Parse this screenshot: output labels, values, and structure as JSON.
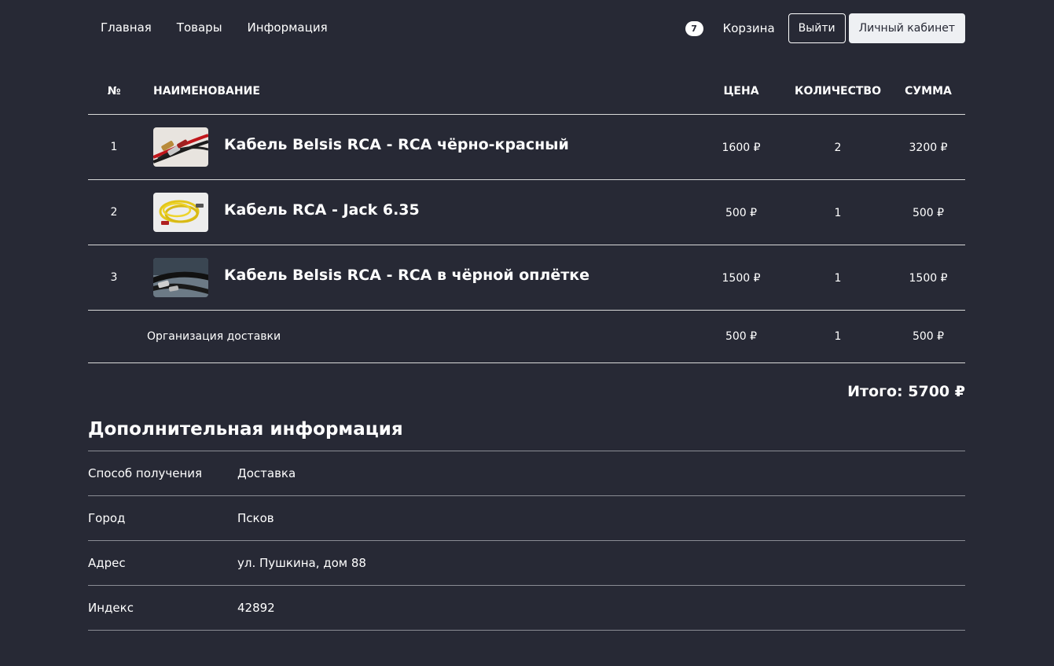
{
  "nav": {
    "links": [
      "Главная",
      "Товары",
      "Информация"
    ],
    "cart_count": "7",
    "cart_label": "Корзина",
    "logout_label": "Выйти",
    "account_label": "Личный кабинет"
  },
  "table": {
    "headers": {
      "num": "№",
      "name": "НАИМЕНОВАНИЕ",
      "price": "ЦЕНА",
      "qty": "КОЛИЧЕСТВО",
      "sum": "СУММА"
    },
    "items": [
      {
        "num": "1",
        "name": "Кабель Belsis RCA - RCA чёрно-красный",
        "price": "1600 ₽",
        "qty": "2",
        "sum": "3200 ₽",
        "thumb": "red-black-rca-cable-icon"
      },
      {
        "num": "2",
        "name": "Кабель RCA - Jack 6.35",
        "price": "500 ₽",
        "qty": "1",
        "sum": "500 ₽",
        "thumb": "yellow-cable-icon"
      },
      {
        "num": "3",
        "name": "Кабель Belsis RCA - RCA в чёрной оплётке",
        "price": "1500 ₽",
        "qty": "1",
        "sum": "1500 ₽",
        "thumb": "black-braided-cable-icon"
      }
    ],
    "delivery": {
      "label": "Организация доставки",
      "price": "500 ₽",
      "qty": "1",
      "sum": "500 ₽"
    }
  },
  "total": "Итого: 5700 ₽",
  "info": {
    "title": "Дополнительная информация",
    "rows": [
      {
        "label": "Способ получения",
        "value": "Доставка"
      },
      {
        "label": "Город",
        "value": "Псков"
      },
      {
        "label": "Адрес",
        "value": "ул. Пушкина, дом 88"
      },
      {
        "label": "Индекс",
        "value": "42892"
      }
    ]
  }
}
